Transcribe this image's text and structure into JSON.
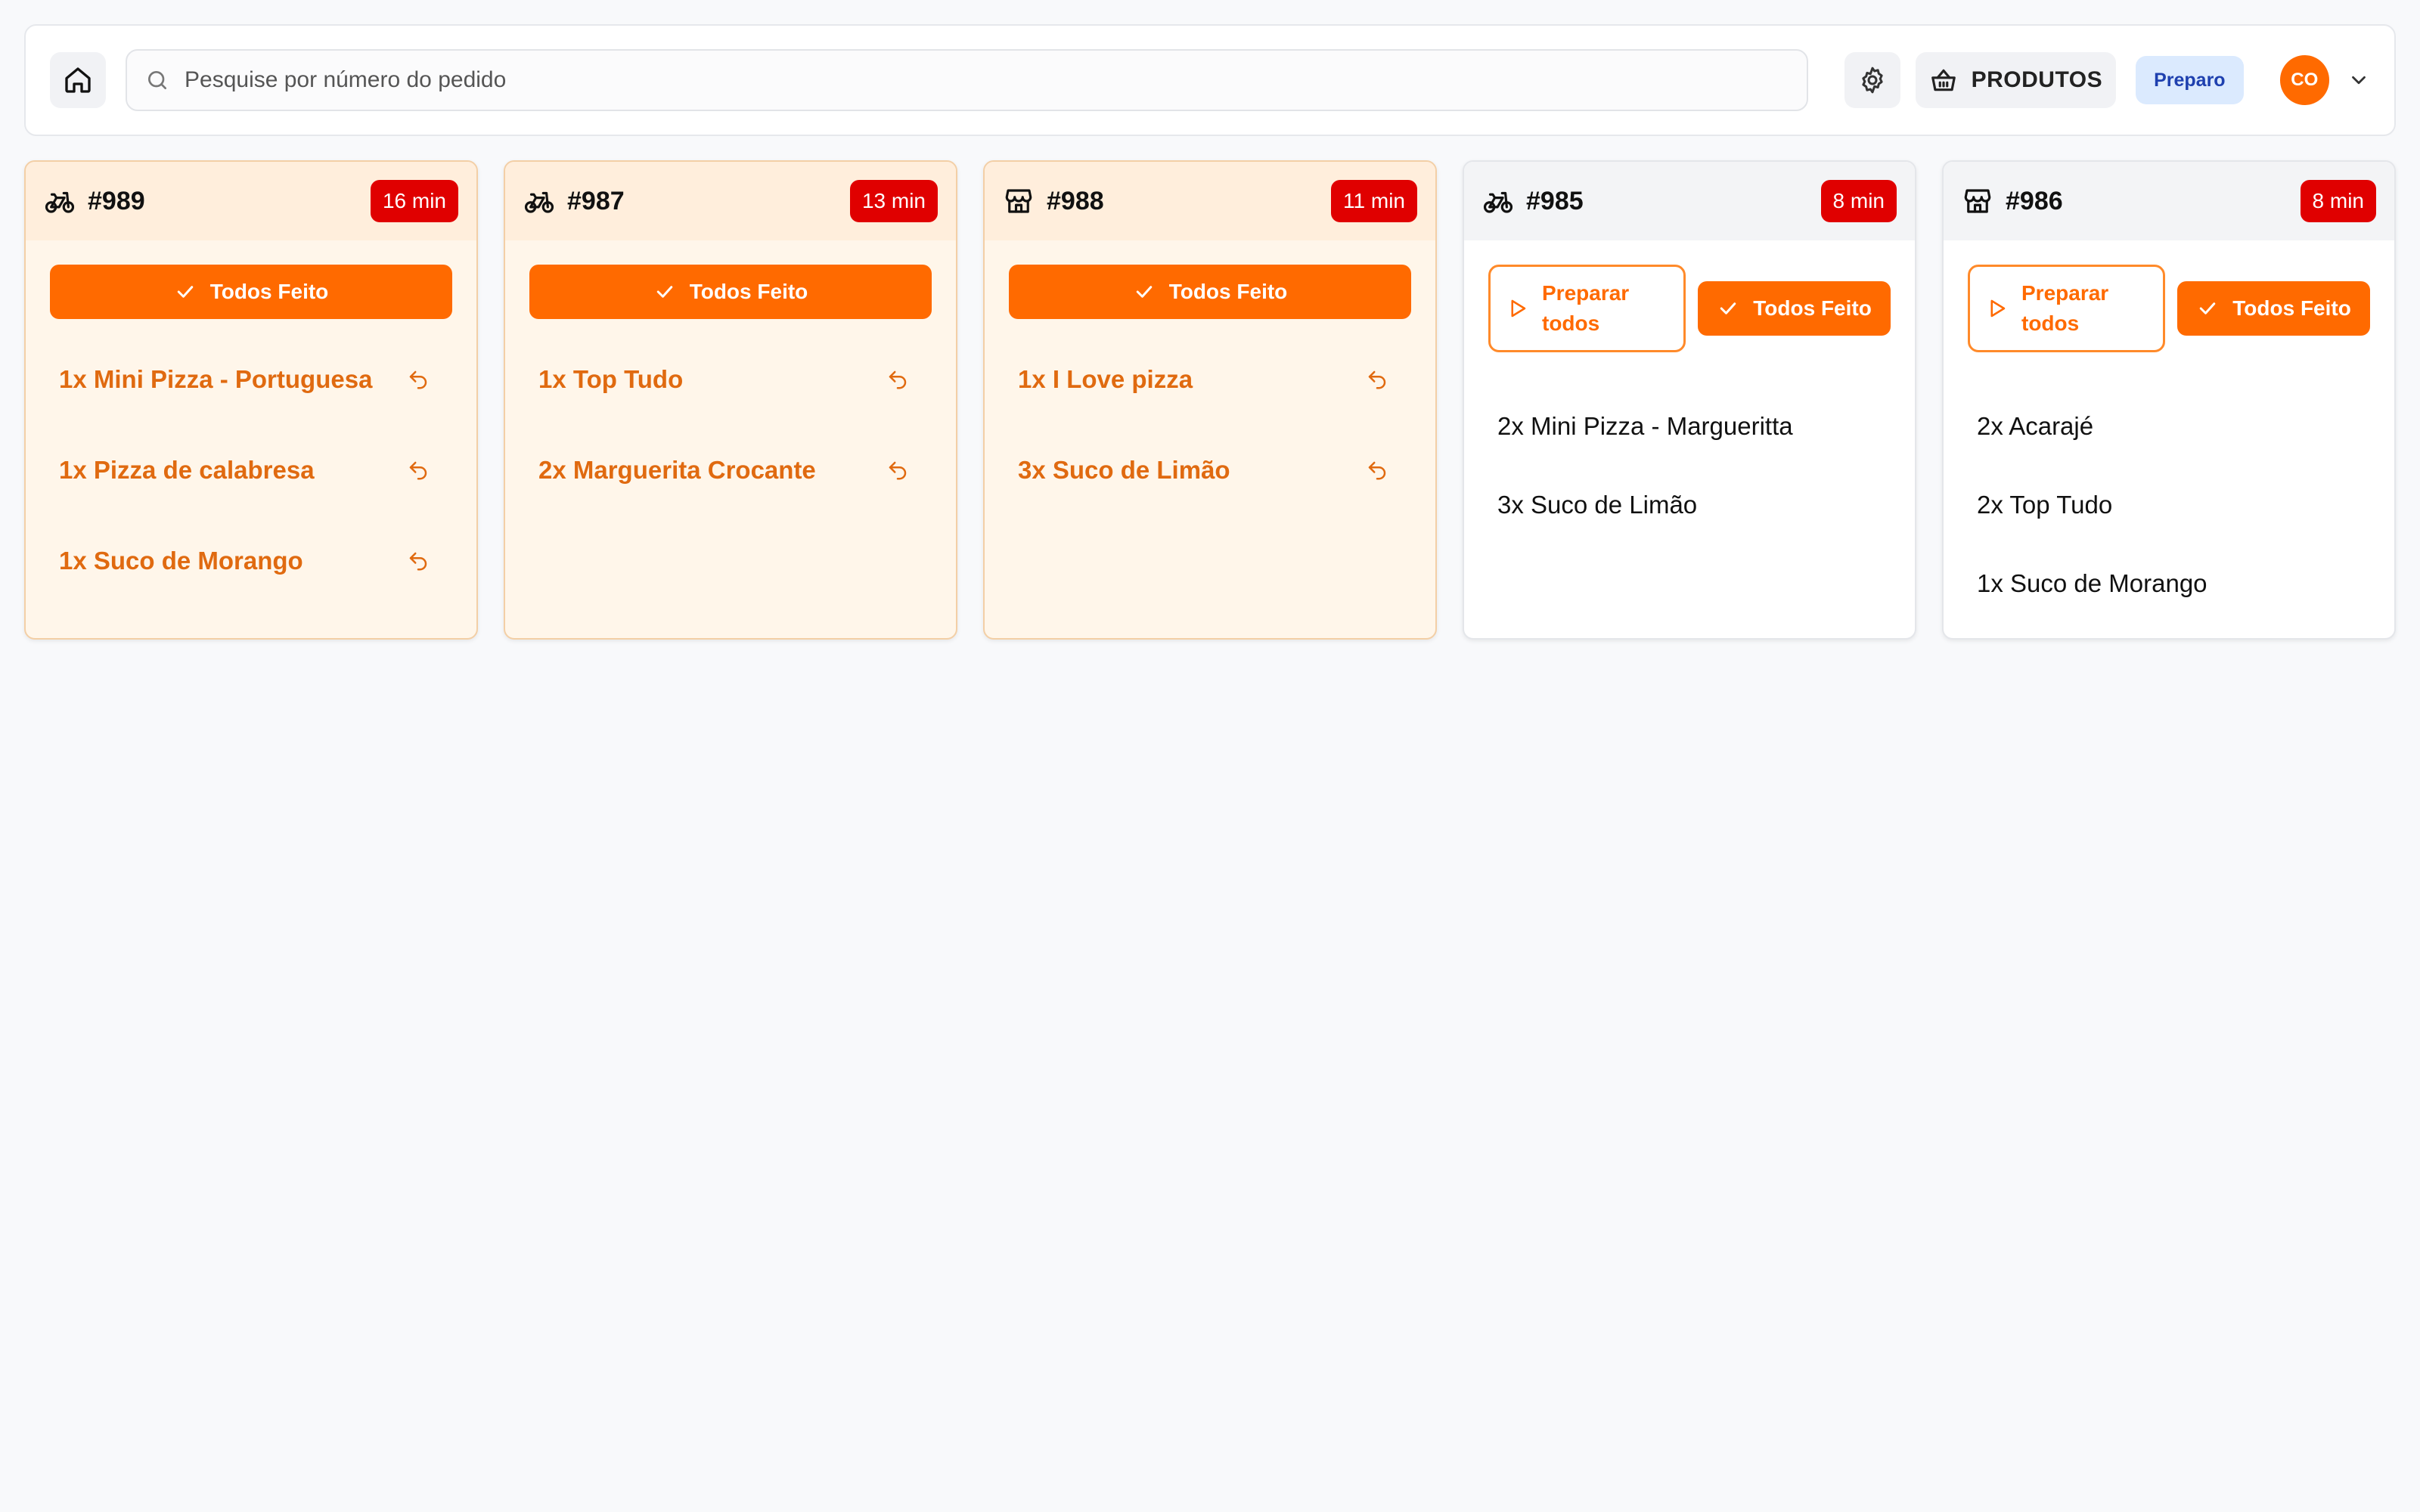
{
  "search": {
    "placeholder": "Pesquise por número do pedido"
  },
  "header": {
    "products_label": "PRODUTOS",
    "mode_badge": "Preparo",
    "avatar_initials": "CO"
  },
  "colors": {
    "accent": "#ff6a00",
    "timer": "#e00000",
    "badge_bg": "#dbeafe",
    "badge_text": "#1e40af"
  },
  "orders": [
    {
      "number": "#989",
      "type_icon": "bike-icon",
      "elapsed": "16 min",
      "status": "in-progress",
      "done_label": "Todos Feito",
      "items": [
        "1x Mini Pizza - Portuguesa",
        "1x Pizza de calabresa",
        "1x Suco de Morango"
      ]
    },
    {
      "number": "#987",
      "type_icon": "bike-icon",
      "elapsed": "13 min",
      "status": "in-progress",
      "done_label": "Todos Feito",
      "items": [
        "1x Top Tudo",
        "2x Marguerita Crocante"
      ]
    },
    {
      "number": "#988",
      "type_icon": "store-icon",
      "elapsed": "11 min",
      "status": "in-progress",
      "done_label": "Todos Feito",
      "items": [
        "1x I Love pizza",
        "3x Suco de Limão"
      ]
    },
    {
      "number": "#985",
      "type_icon": "bike-icon",
      "elapsed": "8 min",
      "status": "new",
      "prepare_label": "Preparar todos",
      "done_label": "Todos Feito",
      "items": [
        "2x Mini Pizza - Margueritta",
        "3x Suco de Limão"
      ]
    },
    {
      "number": "#986",
      "type_icon": "store-icon",
      "elapsed": "8 min",
      "status": "new",
      "prepare_label": "Preparar todos",
      "done_label": "Todos Feito",
      "items": [
        "2x Acarajé",
        "2x Top Tudo",
        "1x Suco de Morango"
      ]
    }
  ]
}
